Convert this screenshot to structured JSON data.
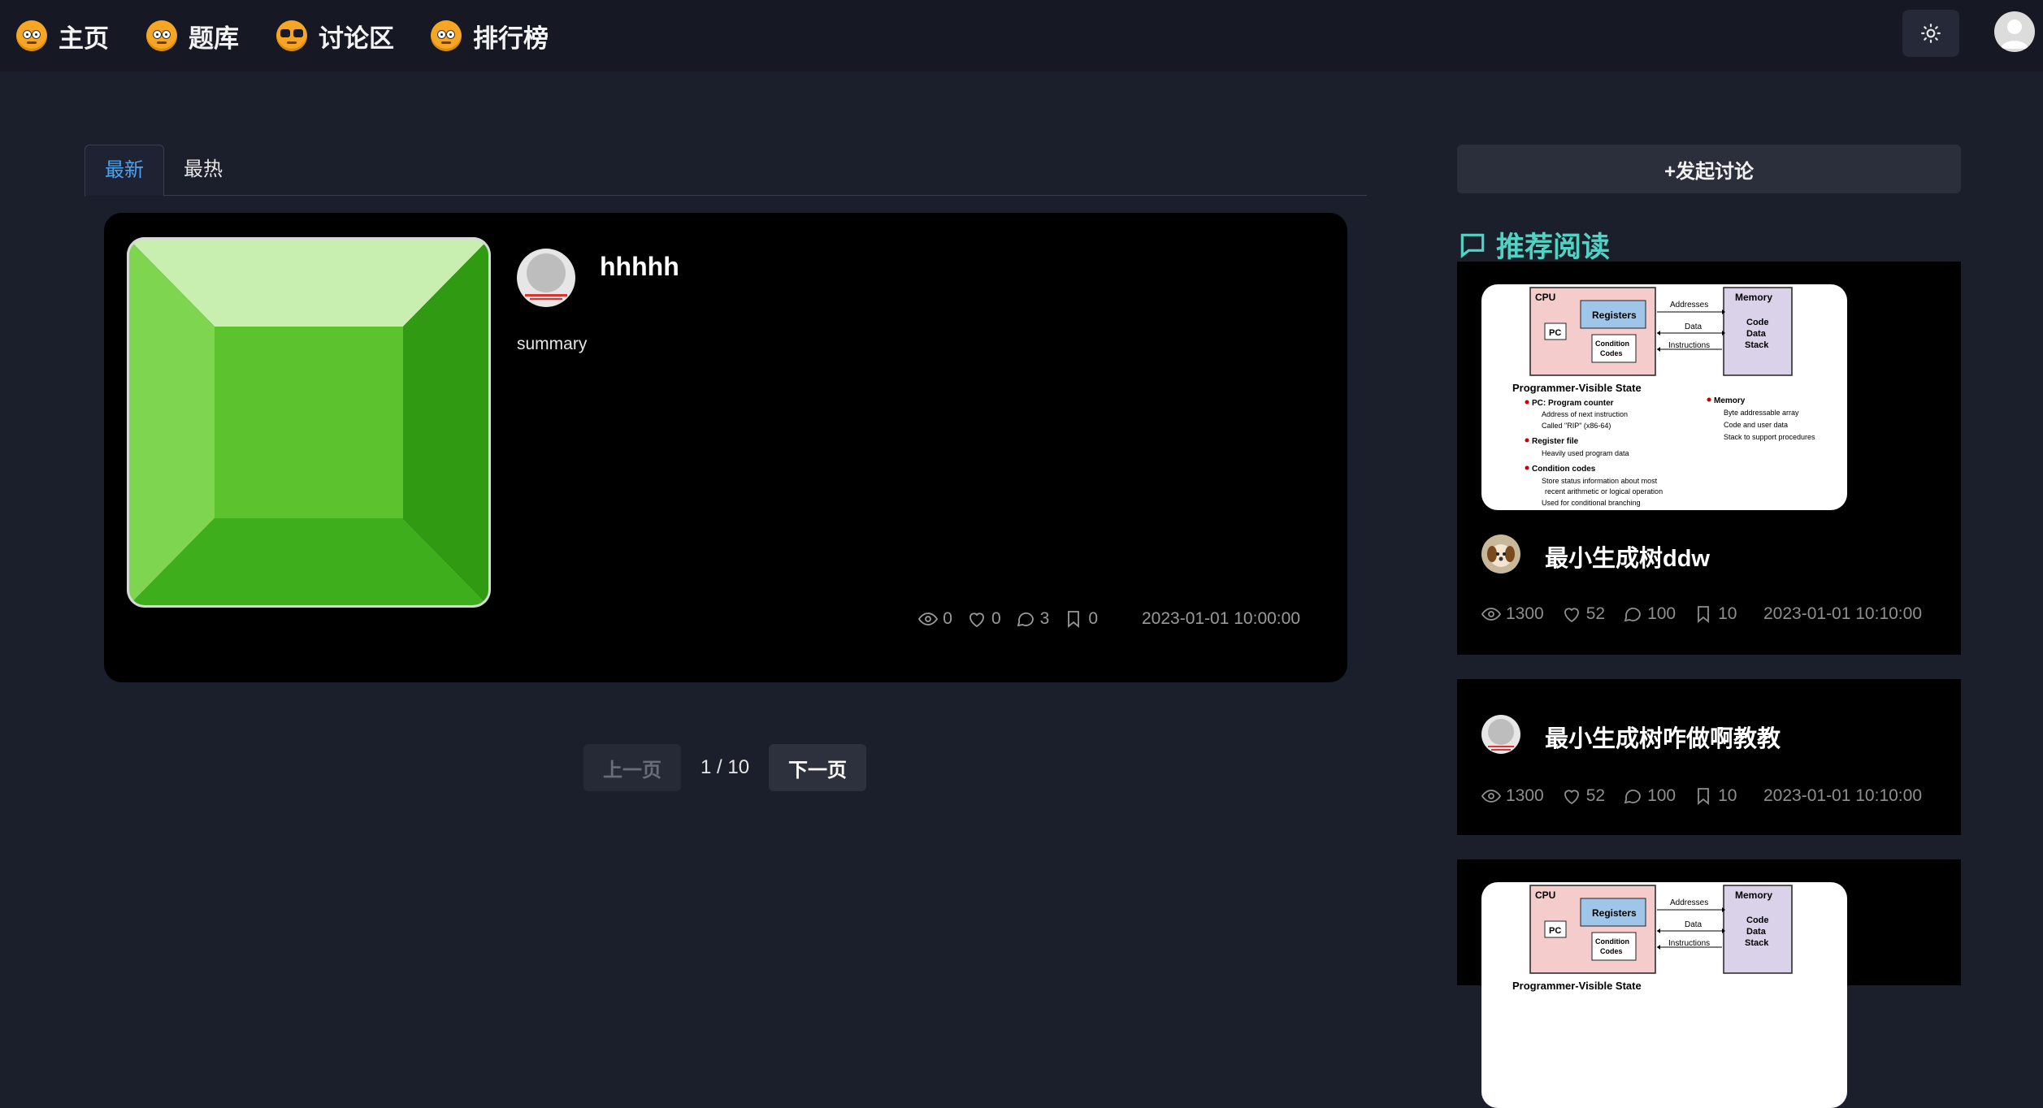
{
  "nav": {
    "items": [
      {
        "label": "主页",
        "icon": "smiley-face-icon"
      },
      {
        "label": "题库",
        "icon": "smiley-face-icon"
      },
      {
        "label": "讨论区",
        "icon": "sunglasses-face-icon"
      },
      {
        "label": "排行榜",
        "icon": "smiley-face-icon"
      }
    ],
    "theme_icon": "sun-icon",
    "avatar_icon": "user-avatar-icon"
  },
  "tabs": [
    "最新",
    "最热"
  ],
  "post": {
    "title": "hhhhh",
    "summary": "summary",
    "stats": {
      "views": "0",
      "likes": "0",
      "comments": "3",
      "bookmarks": "0"
    },
    "date": "2023-01-01 10:00:00"
  },
  "pagination": {
    "prev": "上一页",
    "current": "1 / 10",
    "next": "下一页"
  },
  "sidebar": {
    "new_discussion": "+发起讨论",
    "recommend_title": "推荐阅读",
    "accent": "#4fd4c4",
    "items": [
      {
        "title": "最小生成树ddw",
        "stats": {
          "views": "1300",
          "likes": "52",
          "comments": "100",
          "bookmarks": "10"
        },
        "date": "2023-01-01 10:10:00"
      },
      {
        "title": "最小生成树咋做啊教教",
        "stats": {
          "views": "1300",
          "likes": "52",
          "comments": "100",
          "bookmarks": "10"
        },
        "date": "2023-01-01 10:10:00"
      }
    ]
  },
  "thumbnail": {
    "cpu": "CPU",
    "pc": "PC",
    "registers": "Registers",
    "condition_codes": "Condition Codes",
    "memory": "Memory",
    "memory_contents": [
      "Code",
      "Data",
      "Stack"
    ],
    "arrows": [
      "Addresses",
      "Data",
      "Instructions"
    ],
    "heading": "Programmer-Visible State",
    "left_list": [
      {
        "head": "PC: Program counter",
        "subs": [
          "Address of next instruction",
          "Called \"RIP\" (x86-64)"
        ]
      },
      {
        "head": "Register file",
        "subs": [
          "Heavily used program data"
        ]
      },
      {
        "head": "Condition codes",
        "subs": [
          "Store status information about most",
          "recent arithmetic or logical operation",
          "Used for conditional branching"
        ]
      }
    ],
    "right_list": {
      "head": "Memory",
      "subs": [
        "Byte addressable array",
        "Code and user data",
        "Stack to support procedures"
      ]
    }
  }
}
